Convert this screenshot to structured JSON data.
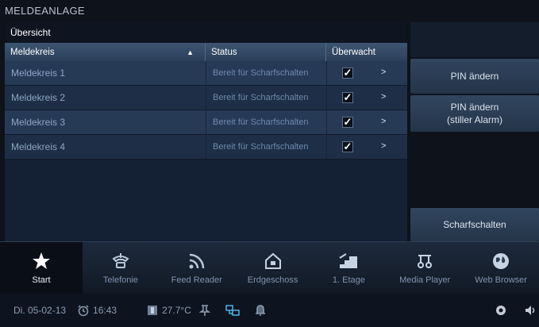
{
  "app": {
    "title": "MELDEANLAGE"
  },
  "panel": {
    "header": "Übersicht",
    "columns": {
      "meldekreis": "Meldekreis",
      "status": "Status",
      "ueberwacht": "Überwacht"
    }
  },
  "rows": [
    {
      "name": "Meldekreis 1",
      "status": "Bereit für Scharfschalten",
      "checked": true
    },
    {
      "name": "Meldekreis 2",
      "status": "Bereit für Scharfschalten",
      "checked": true
    },
    {
      "name": "Meldekreis 3",
      "status": "Bereit für Scharfschalten",
      "checked": true
    },
    {
      "name": "Meldekreis 4",
      "status": "Bereit für Scharfschalten",
      "checked": true
    }
  ],
  "side": {
    "pin_change": "PIN ändern",
    "pin_silent_1": "PIN ändern",
    "pin_silent_2": "(stiller Alarm)",
    "arm": "Scharfschalten"
  },
  "taskbar": [
    {
      "label": "Start",
      "icon": "star-icon"
    },
    {
      "label": "Telefonie",
      "icon": "phone-icon"
    },
    {
      "label": "Feed Reader",
      "icon": "feed-icon"
    },
    {
      "label": "Erdgeschoss",
      "icon": "house-icon"
    },
    {
      "label": "1. Etage",
      "icon": "stairs-icon"
    },
    {
      "label": "Media Player",
      "icon": "media-icon"
    },
    {
      "label": "Web Browser",
      "icon": "globe-icon"
    }
  ],
  "status": {
    "date": "Di. 05-02-13",
    "time": "16:43",
    "temperature": "27.7°C"
  },
  "colors": {
    "accent": "#4fb3e8",
    "panel": "#142033",
    "button": "#31455f"
  }
}
